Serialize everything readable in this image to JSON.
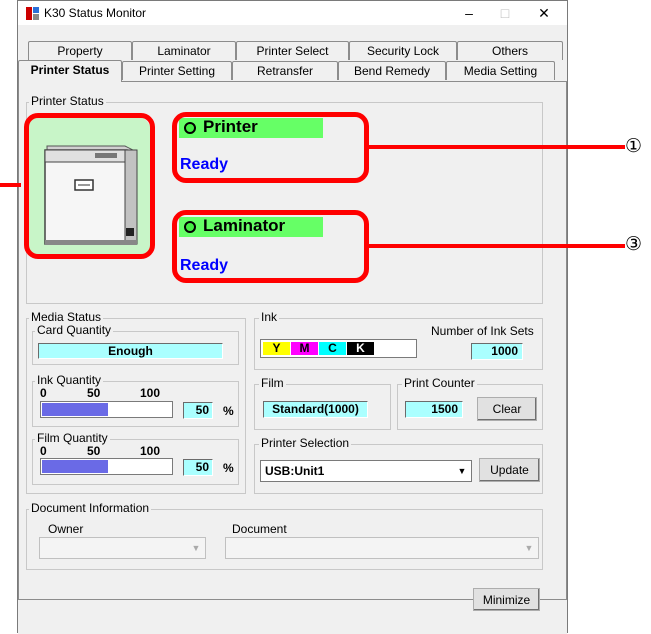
{
  "window": {
    "title": "K30 Status Monitor",
    "min": "–",
    "max": "□",
    "close": "✕"
  },
  "tabs_row1": [
    "Property",
    "Laminator",
    "Printer Select",
    "Security Lock",
    "Others"
  ],
  "tabs_row2": [
    "Printer Status",
    "Printer Setting",
    "Retransfer",
    "Bend Remedy",
    "Media Setting"
  ],
  "active_tab": "Printer Status",
  "printer_status": {
    "group_label": "Printer Status",
    "printer_label": "Printer",
    "printer_state": "Ready",
    "laminator_label": "Laminator",
    "laminator_state": "Ready"
  },
  "callouts": {
    "printer": "①",
    "laminator": "③"
  },
  "media_status": {
    "group_label": "Media Status",
    "card_quantity_label": "Card Quantity",
    "card_quantity_value": "Enough",
    "ink_quantity_label": "Ink Quantity",
    "ink_quantity_percent": "50",
    "film_quantity_label": "Film Quantity",
    "film_quantity_percent": "50",
    "scale_0": "0",
    "scale_50": "50",
    "scale_100": "100",
    "percent_sign": "%"
  },
  "ink": {
    "group_label": "Ink",
    "colors": [
      {
        "letter": "Y",
        "bg": "#ffff00",
        "fg": "#000000"
      },
      {
        "letter": "M",
        "bg": "#ff00ff",
        "fg": "#000000"
      },
      {
        "letter": "C",
        "bg": "#00ffff",
        "fg": "#000000"
      },
      {
        "letter": "K",
        "bg": "#000000",
        "fg": "#ffffff"
      }
    ],
    "sets_label": "Number of Ink Sets",
    "sets_value": "1000"
  },
  "film": {
    "group_label": "Film",
    "value": "Standard(1000)"
  },
  "print_counter": {
    "group_label": "Print Counter",
    "value": "1500",
    "clear_label": "Clear"
  },
  "printer_selection": {
    "group_label": "Printer Selection",
    "value": "USB:Unit1",
    "update_label": "Update"
  },
  "document_information": {
    "group_label": "Document Information",
    "owner_label": "Owner",
    "document_label": "Document",
    "owner_value": "",
    "document_value": ""
  },
  "minimize_label": "Minimize",
  "colors": {
    "annotation_red": "#ff0000",
    "status_green": "#66ff66",
    "ready_blue": "#0000ff",
    "printer_bg": "#c8f5c8"
  }
}
